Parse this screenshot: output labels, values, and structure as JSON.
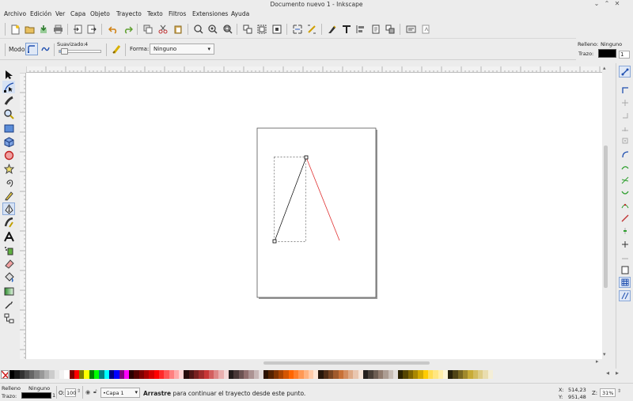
{
  "window": {
    "title": "Documento nuevo 1 - Inkscape",
    "controls": [
      "⌄",
      "⌃",
      "✕"
    ]
  },
  "menu": [
    "Archivo",
    "Edición",
    "Ver",
    "Capa",
    "Objeto",
    "Trayecto",
    "Texto",
    "Filtros",
    "Extensiones",
    "Ayuda"
  ],
  "tool_controls": {
    "mode_label": "Modo:",
    "smoothing_label": "Suavizado:",
    "smoothing_value": "4",
    "shape_label": "Forma:",
    "shape_value": "Ninguno"
  },
  "fill_stroke_top": {
    "fill_label": "Relleno:",
    "fill_value": "Ninguno",
    "stroke_label": "Trazo:",
    "stroke_width": "1",
    "stroke_color": "#000000"
  },
  "canvas": {
    "path_stroke": "#000000",
    "preview_stroke": "#e03030",
    "page_border": "#555555"
  },
  "palette": {
    "colors": [
      "#000000",
      "#1a1a1a",
      "#333333",
      "#4d4d4d",
      "#666666",
      "#808080",
      "#999999",
      "#b3b3b3",
      "#cccccc",
      "#e6e6e6",
      "#f2f2f2",
      "#ffffff",
      "#800000",
      "#ff0000",
      "#808000",
      "#ffff00",
      "#008000",
      "#00ff00",
      "#008080",
      "#00ffff",
      "#000080",
      "#0000ff",
      "#800080",
      "#ff00ff",
      "#2b0000",
      "#550000",
      "#800000",
      "#aa0000",
      "#d40000",
      "#ff0000",
      "#ff2a2a",
      "#ff5555",
      "#ff8080",
      "#ffaaaa",
      "#ffd5d5",
      "#280b0b",
      "#501616",
      "#782121",
      "#a02c2c",
      "#c83737",
      "#d35f5f",
      "#de8787",
      "#e9afaf",
      "#f4d7d7",
      "#241c1c",
      "#483737",
      "#6c5353",
      "#916f6f",
      "#ac9393",
      "#c8b7b7",
      "#e3dbdb",
      "#2b1100",
      "#552200",
      "#803300",
      "#aa4400",
      "#d45500",
      "#ff6600",
      "#ff7f2a",
      "#ff9955",
      "#ffb380",
      "#ffccaa",
      "#ffe6d5",
      "#28170b",
      "#502d16",
      "#784421",
      "#a05a2c",
      "#c87137",
      "#d38d5f",
      "#deaa87",
      "#e9c6af",
      "#f4e3d7",
      "#241f1c",
      "#483e37",
      "#6c5d53",
      "#917c6f",
      "#ac9d93",
      "#c8beb7",
      "#e3dedb",
      "#2b2200",
      "#554400",
      "#806600",
      "#aa8800",
      "#d4aa00",
      "#ffcc00",
      "#ffdd55",
      "#ffe680",
      "#ffeeaa",
      "#fff6d5",
      "#28220b",
      "#504416",
      "#786721",
      "#a0892c",
      "#c8ab37",
      "#d3bc5f",
      "#decd87",
      "#e9ddaf",
      "#f4eed7"
    ]
  },
  "status": {
    "fill_label": "Relleno",
    "fill_value": "Ninguno",
    "stroke_label": "Trazo:",
    "stroke_width": "1",
    "opacity_label": "O:",
    "opacity_value": "100",
    "layer": "•Capa 1",
    "message_bold": "Arrastre",
    "message_rest": " para continuar el trayecto desde este punto.",
    "x_label": "X:",
    "x_value": "514,23",
    "y_label": "Y:",
    "y_value": "951,48",
    "zoom_label": "Z:",
    "zoom_value": "31%"
  }
}
